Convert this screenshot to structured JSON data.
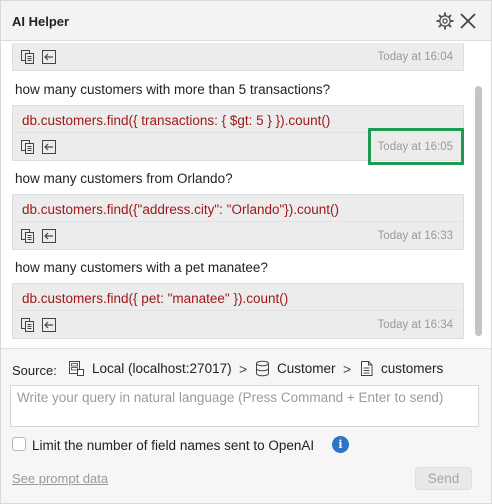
{
  "window": {
    "title": "AI Helper"
  },
  "history": [
    {
      "question": "",
      "query": "",
      "time": "Today at 16:04"
    },
    {
      "question": "how many customers with more than 5 transactions?",
      "query": "db.customers.find({ transactions: { $gt: 5 } }).count()",
      "time": "Today at 16:05"
    },
    {
      "question": "how many customers from Orlando?",
      "query": "db.customers.find({\"address.city\": \"Orlando\"}).count()",
      "time": "Today at 16:33"
    },
    {
      "question": "how many customers with a pet manatee?",
      "query": "db.customers.find({ pet: \"manatee\" }).count()",
      "time": "Today at 16:34"
    }
  ],
  "source": {
    "label": "Source:",
    "connection": "Local (localhost:27017)",
    "database": "Customer",
    "collection": "customers"
  },
  "query_input": {
    "placeholder": "Write your query in natural language (Press Command + Enter to send)",
    "value": ""
  },
  "limit_fields": {
    "label": "Limit the number of field names sent to OpenAI",
    "checked": false
  },
  "info_glyph": "i",
  "prompt_link": "See prompt data",
  "send_label": "Send",
  "colors": {
    "code": "#a01818",
    "highlight": "#1f9a55",
    "info": "#2d73c8"
  }
}
